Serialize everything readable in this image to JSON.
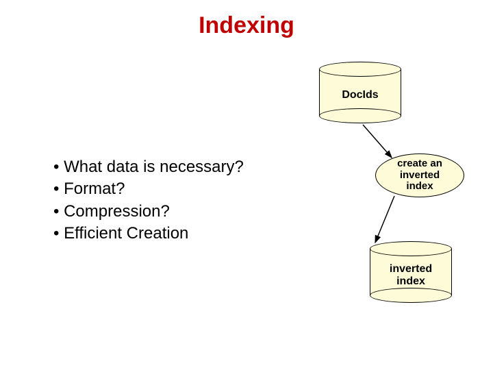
{
  "title": "Indexing",
  "bullets": {
    "b1": "What data is necessary?",
    "b2": "Format?",
    "b3": "Compression?",
    "b4": "Efficient Creation"
  },
  "cylinders": {
    "docids": "DocIds",
    "invindex_l1": "inverted",
    "invindex_l2": "index"
  },
  "process": {
    "l1": "create an",
    "l2": "inverted",
    "l3": "index"
  }
}
